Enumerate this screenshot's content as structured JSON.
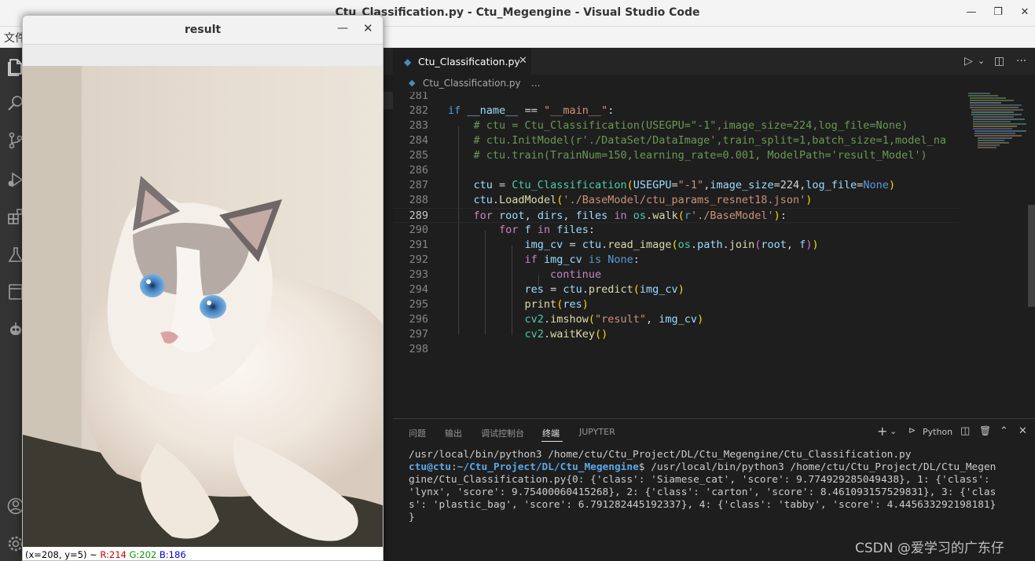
{
  "window": {
    "title": "Ctu_Classification.py - Ctu_Megengine - Visual Studio Code",
    "minimize_glyph": "—",
    "maximize_glyph": "❐",
    "close_glyph": "✕"
  },
  "menubar": {
    "first_item": "文件"
  },
  "activity_bar": {
    "icons": [
      "explorer-icon",
      "search-icon",
      "source-control-icon",
      "run-debug-icon",
      "extensions-icon",
      "testing-icon",
      "notebook-icon",
      "remote-robot-icon",
      "account-icon",
      "manage-gear-icon"
    ]
  },
  "editor": {
    "tab": {
      "label": "Ctu_Classification.py",
      "icon": "python-icon",
      "close": "✕"
    },
    "actions": {
      "run": "▷",
      "run_dropdown": "⌄",
      "split": "◫",
      "more": "···"
    },
    "breadcrumb": {
      "file": "Ctu_Classification.py",
      "more": "..."
    },
    "lines": [
      {
        "n": "281",
        "code": ""
      },
      {
        "n": "282",
        "code": "if __name__ == \"__main__\":"
      },
      {
        "n": "283",
        "code": "    # ctu = Ctu_Classification(USEGPU=\"-1\",image_size=224,log_file=None)"
      },
      {
        "n": "284",
        "code": "    # ctu.InitModel(r'./DataSet/DataImage',train_split=1,batch_size=1,model_na"
      },
      {
        "n": "285",
        "code": "    # ctu.train(TrainNum=150,learning_rate=0.001, ModelPath='result_Model')"
      },
      {
        "n": "286",
        "code": ""
      },
      {
        "n": "287",
        "code": "    ctu = Ctu_Classification(USEGPU=\"-1\",image_size=224,log_file=None)"
      },
      {
        "n": "288",
        "code": "    ctu.LoadModel('./BaseModel/ctu_params_resnet18.json')"
      },
      {
        "n": "289",
        "code": "    for root, dirs, files in os.walk(r'./BaseModel'):"
      },
      {
        "n": "290",
        "code": "        for f in files:"
      },
      {
        "n": "291",
        "code": "            img_cv = ctu.read_image(os.path.join(root, f))"
      },
      {
        "n": "292",
        "code": "            if img_cv is None:"
      },
      {
        "n": "293",
        "code": "                continue"
      },
      {
        "n": "294",
        "code": "            res = ctu.predict(img_cv)"
      },
      {
        "n": "295",
        "code": "            print(res)"
      },
      {
        "n": "296",
        "code": "            cv2.imshow(\"result\", img_cv)"
      },
      {
        "n": "297",
        "code": "            cv2.waitKey()"
      },
      {
        "n": "298",
        "code": ""
      }
    ]
  },
  "panel": {
    "tabs": [
      "问题",
      "输出",
      "调试控制台",
      "终端",
      "JUPYTER"
    ],
    "active_tab": "终端",
    "actions": {
      "add": "+",
      "add_dropdown": "⌄",
      "shell_label": "Python",
      "split": "◫",
      "trash": "🗑",
      "maximize": "⌃",
      "close": "✕"
    },
    "terminal": {
      "line1": "/usr/local/bin/python3 /home/ctu/Ctu_Project/DL/Ctu_Megengine/Ctu_Classification.py",
      "prompt_user": "ctu@ctu",
      "prompt_sep": ":",
      "prompt_path": "~/Ctu_Project/DL/Ctu_Megengine",
      "cmd_line2": "$ /usr/local/bin/python3 /home/ctu/Ctu_Project/DL/Ctu_Megen",
      "line3": "gine/Ctu_Classification.py{0: {'class': 'Siamese_cat', 'score': 9.774929285049438}, 1: {'class':",
      "line4": "'lynx', 'score': 9.75400060415268}, 2: {'class': 'carton', 'score': 8.461093157529831}, 3: {'clas",
      "line5": "s': 'plastic_bag', 'score': 6.791282445192337}, 4: {'class': 'tabby', 'score': 4.445633292198181}",
      "line6": "}"
    }
  },
  "watermark": "CSDN @爱学习的广东仔",
  "cv_window": {
    "title": "result",
    "minimize": "—",
    "close": "✕",
    "image_subject": "ragdoll-cat-photo",
    "status": {
      "coords": "(x=208, y=5) ~ ",
      "r": "R:214",
      "g": "G:202",
      "b": "B:186"
    }
  }
}
